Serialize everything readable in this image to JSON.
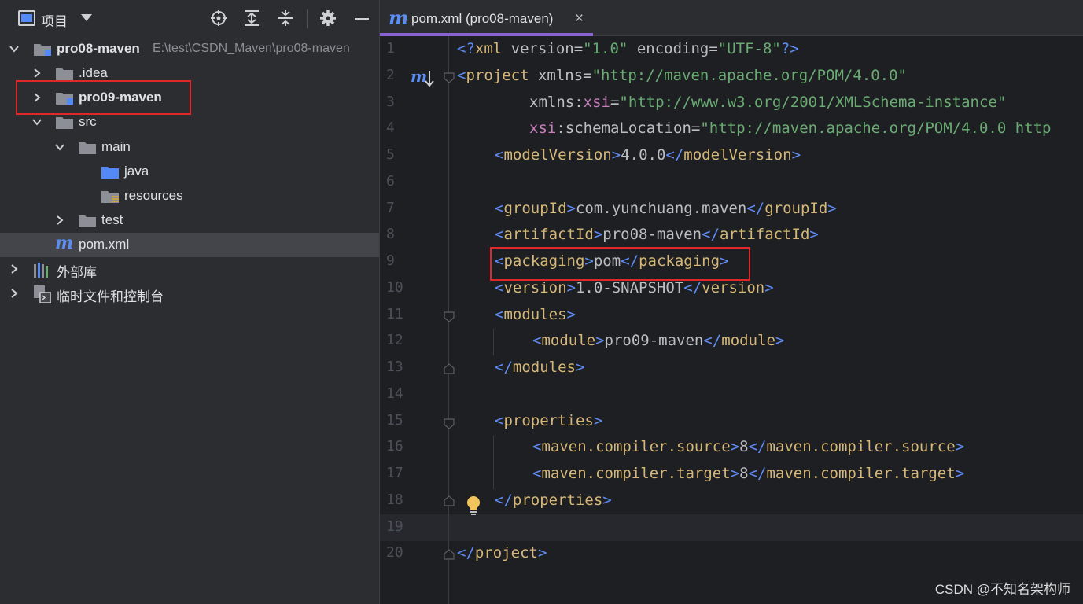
{
  "panel": {
    "title": "项目",
    "icons": [
      "locate-icon",
      "expand-all-icon",
      "collapse-all-icon",
      "gear-icon",
      "minimize-icon"
    ]
  },
  "tree": {
    "root": {
      "label": "pro08-maven",
      "path": "E:\\test\\CSDN_Maven\\pro08-maven"
    },
    "idea": {
      "label": ".idea"
    },
    "pro09": {
      "label": "pro09-maven"
    },
    "src": {
      "label": "src"
    },
    "main": {
      "label": "main"
    },
    "java": {
      "label": "java"
    },
    "resources": {
      "label": "resources"
    },
    "test": {
      "label": "test"
    },
    "pom": {
      "label": "pom.xml"
    },
    "libs": {
      "label": "外部库"
    },
    "scratches": {
      "label": "临时文件和控制台"
    }
  },
  "editor": {
    "tab_label": "pom.xml (pro08-maven)",
    "tab_close": "×",
    "tab_icon_letter": "m",
    "line_numbers": [
      "1",
      "2",
      "3",
      "4",
      "5",
      "6",
      "7",
      "8",
      "9",
      "10",
      "11",
      "12",
      "13",
      "14",
      "15",
      "16",
      "17",
      "18",
      "19",
      "20"
    ],
    "code": {
      "l1": {
        "open": "<?",
        "name": "xml",
        "a1": " version=",
        "v1": "\"1.0\"",
        "a2": " encoding=",
        "v2": "\"UTF-8\"",
        "close": "?>"
      },
      "l2": {
        "name": "project",
        "a1": " xmlns=",
        "v1": "\"http://maven.apache.org/POM/4.0.0\""
      },
      "l3": {
        "ns": "xmlns:",
        "nsn": "xsi",
        "eq": "=",
        "v": "\"http://www.w3.org/2001/XMLSchema-instance\""
      },
      "l4": {
        "ns": "xsi",
        "a": ":schemaLocation=",
        "v": "\"http://maven.apache.org/POM/4.0.0 http"
      },
      "l5": {
        "name": "modelVersion",
        "text": "4.0.0"
      },
      "l7": {
        "name": "groupId",
        "text": "com.yunchuang.maven"
      },
      "l8": {
        "name": "artifactId",
        "text": "pro08-maven"
      },
      "l9": {
        "name": "packaging",
        "text": "pom"
      },
      "l10": {
        "name": "version",
        "text": "1.0-SNAPSHOT"
      },
      "l11": {
        "name": "modules"
      },
      "l12": {
        "name": "module",
        "text": "pro09-maven"
      },
      "l13": {
        "name": "modules"
      },
      "l15": {
        "name": "properties"
      },
      "l16": {
        "name": "maven.compiler.source",
        "text": "8"
      },
      "l17": {
        "name": "maven.compiler.target",
        "text": "8"
      },
      "l18": {
        "name": "properties"
      },
      "l20": {
        "name": "project"
      }
    }
  },
  "watermark": "CSDN @不知名架构师",
  "colors": {
    "accent": "#8a63d2",
    "highlight_box": "#e0272a",
    "maven_blue": "#5c8df2"
  }
}
